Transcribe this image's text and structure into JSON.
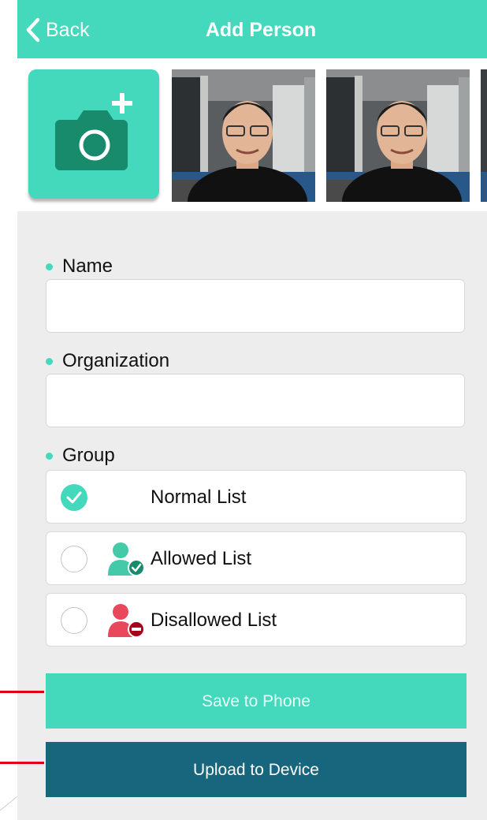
{
  "navbar": {
    "back_label": "Back",
    "title": "Add Person"
  },
  "photos": {
    "add_photo_icon": "camera-plus-icon",
    "thumbnail_count": 3
  },
  "form": {
    "name_label": "Name",
    "name_value": "",
    "organization_label": "Organization",
    "organization_value": "",
    "group_label": "Group",
    "groups": [
      {
        "label": "Normal List",
        "selected": true,
        "icon": ""
      },
      {
        "label": "Allowed List",
        "selected": false,
        "icon": "allowed-person-icon"
      },
      {
        "label": "Disallowed List",
        "selected": false,
        "icon": "disallowed-person-icon"
      }
    ]
  },
  "actions": {
    "save_label": "Save to Phone",
    "upload_label": "Upload to Device"
  },
  "colors": {
    "accent": "#44d8bd",
    "upload": "#17667e",
    "allowed": "#44c9a9",
    "disallowed": "#e8475c",
    "callout": "#e3001b"
  }
}
